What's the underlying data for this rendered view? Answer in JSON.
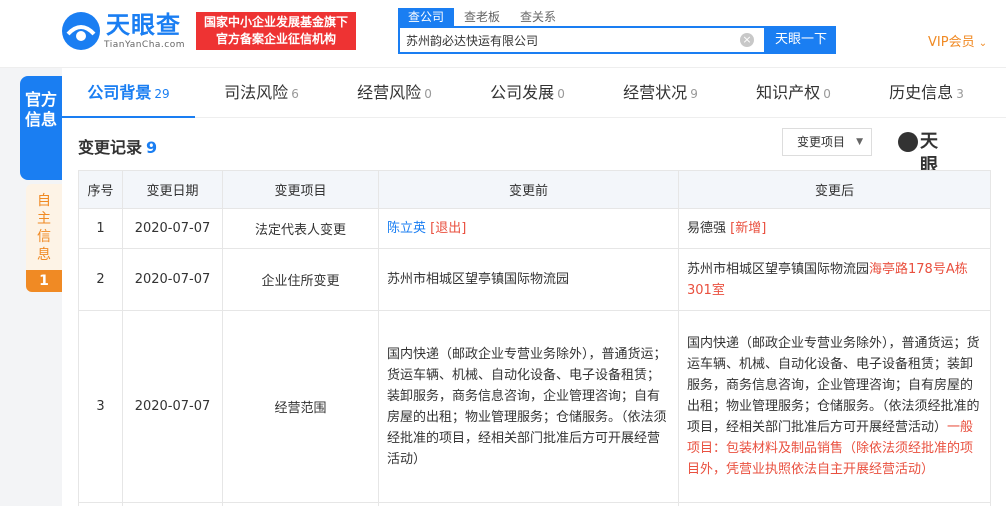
{
  "header": {
    "logo_text": "天眼查",
    "logo_sub": "TianYanCha.com",
    "badge_line1": "国家中小企业发展基金旗下",
    "badge_line2": "官方备案企业征信机构",
    "search_tabs": [
      "查公司",
      "查老板",
      "查关系"
    ],
    "search_value": "苏州韵必达快运有限公司",
    "search_button": "天眼一下",
    "vip": "VIP会员"
  },
  "side": {
    "official": "官方信息",
    "self": "自主信息",
    "self_count": "1"
  },
  "tabs": [
    {
      "label": "公司背景",
      "count": "29"
    },
    {
      "label": "司法风险",
      "count": "6"
    },
    {
      "label": "经营风险",
      "count": "0"
    },
    {
      "label": "公司发展",
      "count": "0"
    },
    {
      "label": "经营状况",
      "count": "9"
    },
    {
      "label": "知识产权",
      "count": "0"
    },
    {
      "label": "历史信息",
      "count": "3"
    }
  ],
  "section": {
    "title": "变更记录",
    "count": "9",
    "filter": "变更项目",
    "watermark": "天眼查"
  },
  "table": {
    "headers": [
      "序号",
      "变更日期",
      "变更项目",
      "变更前",
      "变更后"
    ],
    "rows": [
      {
        "no": "1",
        "date": "2020-07-07",
        "item": "法定代表人变更",
        "before_name": "陈立英",
        "before_tag": "[退出]",
        "after_name": "易德强",
        "after_tag": "[新增]"
      },
      {
        "no": "2",
        "date": "2020-07-07",
        "item": "企业住所变更",
        "before": "苏州市相城区望亭镇国际物流园",
        "after_main": "苏州市相城区望亭镇国际物流园",
        "after_added": "海亭路178号A栋301室"
      },
      {
        "no": "3",
        "date": "2020-07-07",
        "item": "经营范围",
        "before": "国内快递（邮政企业专营业务除外），普通货运；货运车辆、机械、自动化设备、电子设备租赁；装卸服务，商务信息咨询，企业管理咨询；自有房屋的出租；物业管理服务；仓储服务。（依法须经批准的项目，经相关部门批准后方可开展经营活动）",
        "after_main": "国内快递（邮政企业专营业务除外），普通货运；货运车辆、机械、自动化设备、电子设备租赁；装卸服务，商务信息咨询，企业管理咨询；自有房屋的出租；物业管理服务；仓储服务。（依法须经批准的项目，经相关部门批准后方可开展经营活动）",
        "after_added": "一般项目：包装材料及制品销售（除依法须经批准的项目外，凭营业执照依法自主开展经营活动）"
      }
    ]
  }
}
